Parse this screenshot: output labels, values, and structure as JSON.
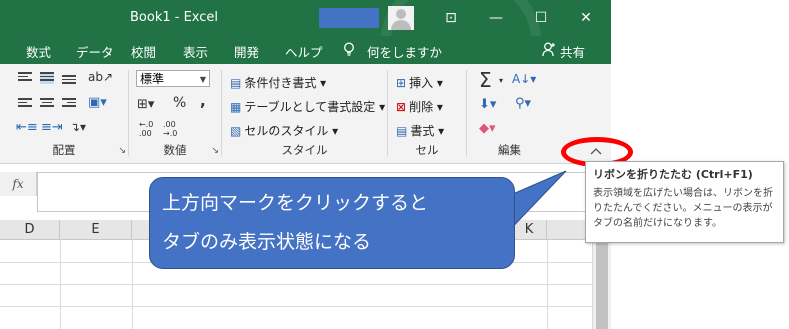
{
  "window": {
    "title": "Book1  -  Excel",
    "controls": {
      "ribbon_display": "⊡",
      "minimize": "—",
      "maximize": "☐",
      "close": "✕"
    }
  },
  "menu_tabs": [
    "数式",
    "データ",
    "校閲",
    "表示",
    "開発",
    "ヘルプ"
  ],
  "tell_me": "何をしますか",
  "share": "共有",
  "ribbon": {
    "alignment": {
      "label": "配置"
    },
    "number": {
      "label": "数値",
      "format_value": "標準",
      "percent": "%",
      "comma": ",",
      "inc_decimal": "←.0\n.00",
      "dec_decimal": ".00\n→.0"
    },
    "styles": {
      "label": "スタイル",
      "conditional": "条件付き書式",
      "as_table": "テーブルとして書式設定",
      "cell_styles": "セルのスタイル"
    },
    "cells": {
      "label": "セル",
      "insert": "挿入",
      "delete": "削除",
      "format": "書式"
    },
    "editing": {
      "label": "編集",
      "sum": "Σ"
    }
  },
  "collapse_glyph": "^",
  "formula_bar": {
    "fx": "fx"
  },
  "columns": [
    "D",
    "E",
    "K"
  ],
  "callout": {
    "line1": "上方向マークをクリックすると",
    "line2": "タブのみ表示状態になる",
    "fill": "#4472c4"
  },
  "tooltip": {
    "title": "リボンを折りたたむ (Ctrl+F1)",
    "body": "表示領域を広げたい場合は、リボンを折りたたんでください。メニューの表示がタブの名前だけになります。"
  },
  "colors": {
    "excel_green": "#217346",
    "highlight_ellipse": "#ff0000"
  }
}
